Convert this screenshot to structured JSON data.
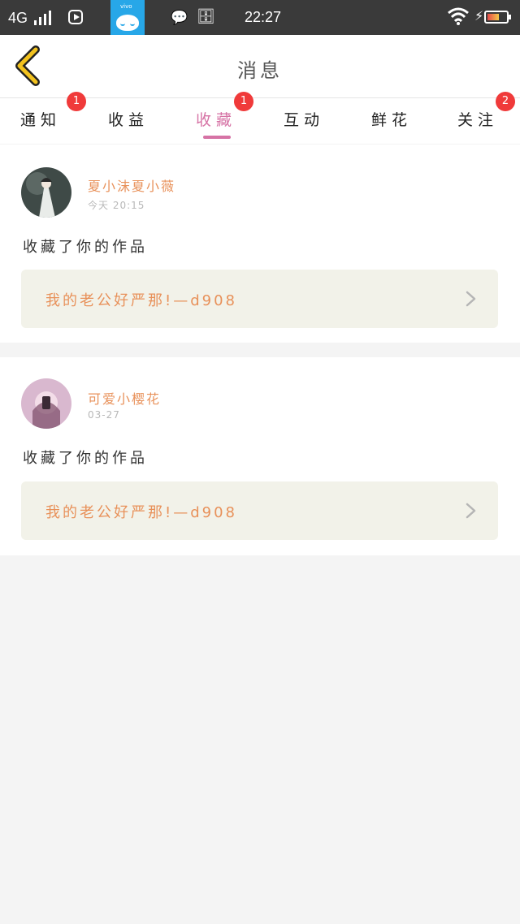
{
  "status_bar": {
    "network": "4G",
    "vivo_label": "vivo",
    "time": "22:27"
  },
  "header": {
    "title": "消息",
    "back_icon": "chevron-left-icon",
    "back_color": "#f2c21e"
  },
  "tabs": [
    {
      "label": "通知",
      "badge": "1",
      "active": false
    },
    {
      "label": "收益",
      "badge": "",
      "active": false
    },
    {
      "label": "收藏",
      "badge": "1",
      "active": true
    },
    {
      "label": "互动",
      "badge": "",
      "active": false
    },
    {
      "label": "鲜花",
      "badge": "",
      "active": false
    },
    {
      "label": "关注",
      "badge": "2",
      "active": false
    }
  ],
  "colors": {
    "accent": "#d673a5",
    "badge": "#f03a3a",
    "name_color": "#e8915a",
    "work_bg": "#f2f2e9"
  },
  "messages": [
    {
      "username": "夏小沫夏小薇",
      "time": "今天 20:15",
      "action": "收藏了你的作品",
      "work_title": "我的老公好严那!—d908"
    },
    {
      "username": "可爱小樱花",
      "time": "03-27",
      "action": "收藏了你的作品",
      "work_title": "我的老公好严那!—d908"
    }
  ]
}
